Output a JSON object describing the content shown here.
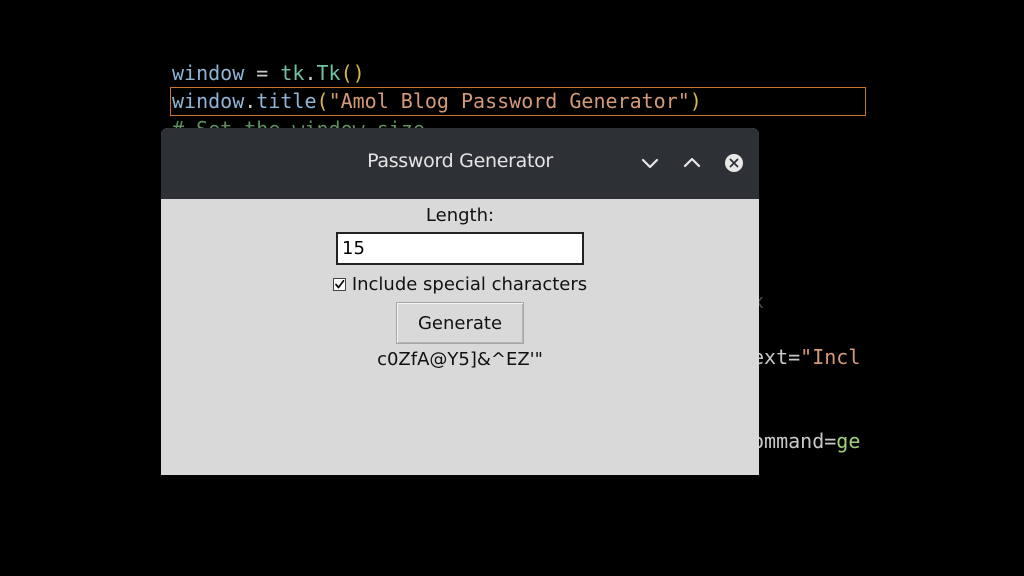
{
  "editor": {
    "line1": {
      "var": "window",
      "op": " = ",
      "mod": "tk",
      "dot": ".",
      "cls": "Tk",
      "par": "()"
    },
    "line2": {
      "var": "window",
      "dot": ".",
      "fn": "title",
      "open": "(",
      "str": "\"Amol Blog Password Generator\"",
      "close": ")"
    },
    "line3": "# Set the window size",
    "frag_x": "x",
    "frag_text_key": "ext=",
    "frag_text_val": "\"Incl",
    "frag_command_key": "ommand=",
    "frag_command_val": "ge"
  },
  "window": {
    "title": "Password Generator",
    "length_label": "Length:",
    "length_value": "15",
    "special_label": "Include special characters",
    "special_checked": true,
    "generate_label": "Generate",
    "password": "c0ZfA@Y5]&^EZ'\""
  },
  "icons": {
    "minimize": "chevron-down-icon",
    "maximize": "chevron-up-icon",
    "close": "close-icon"
  },
  "colors": {
    "titlebar": "#2d3135",
    "window_bg": "#d9d9d9",
    "highlight_border": "#c9732d"
  }
}
